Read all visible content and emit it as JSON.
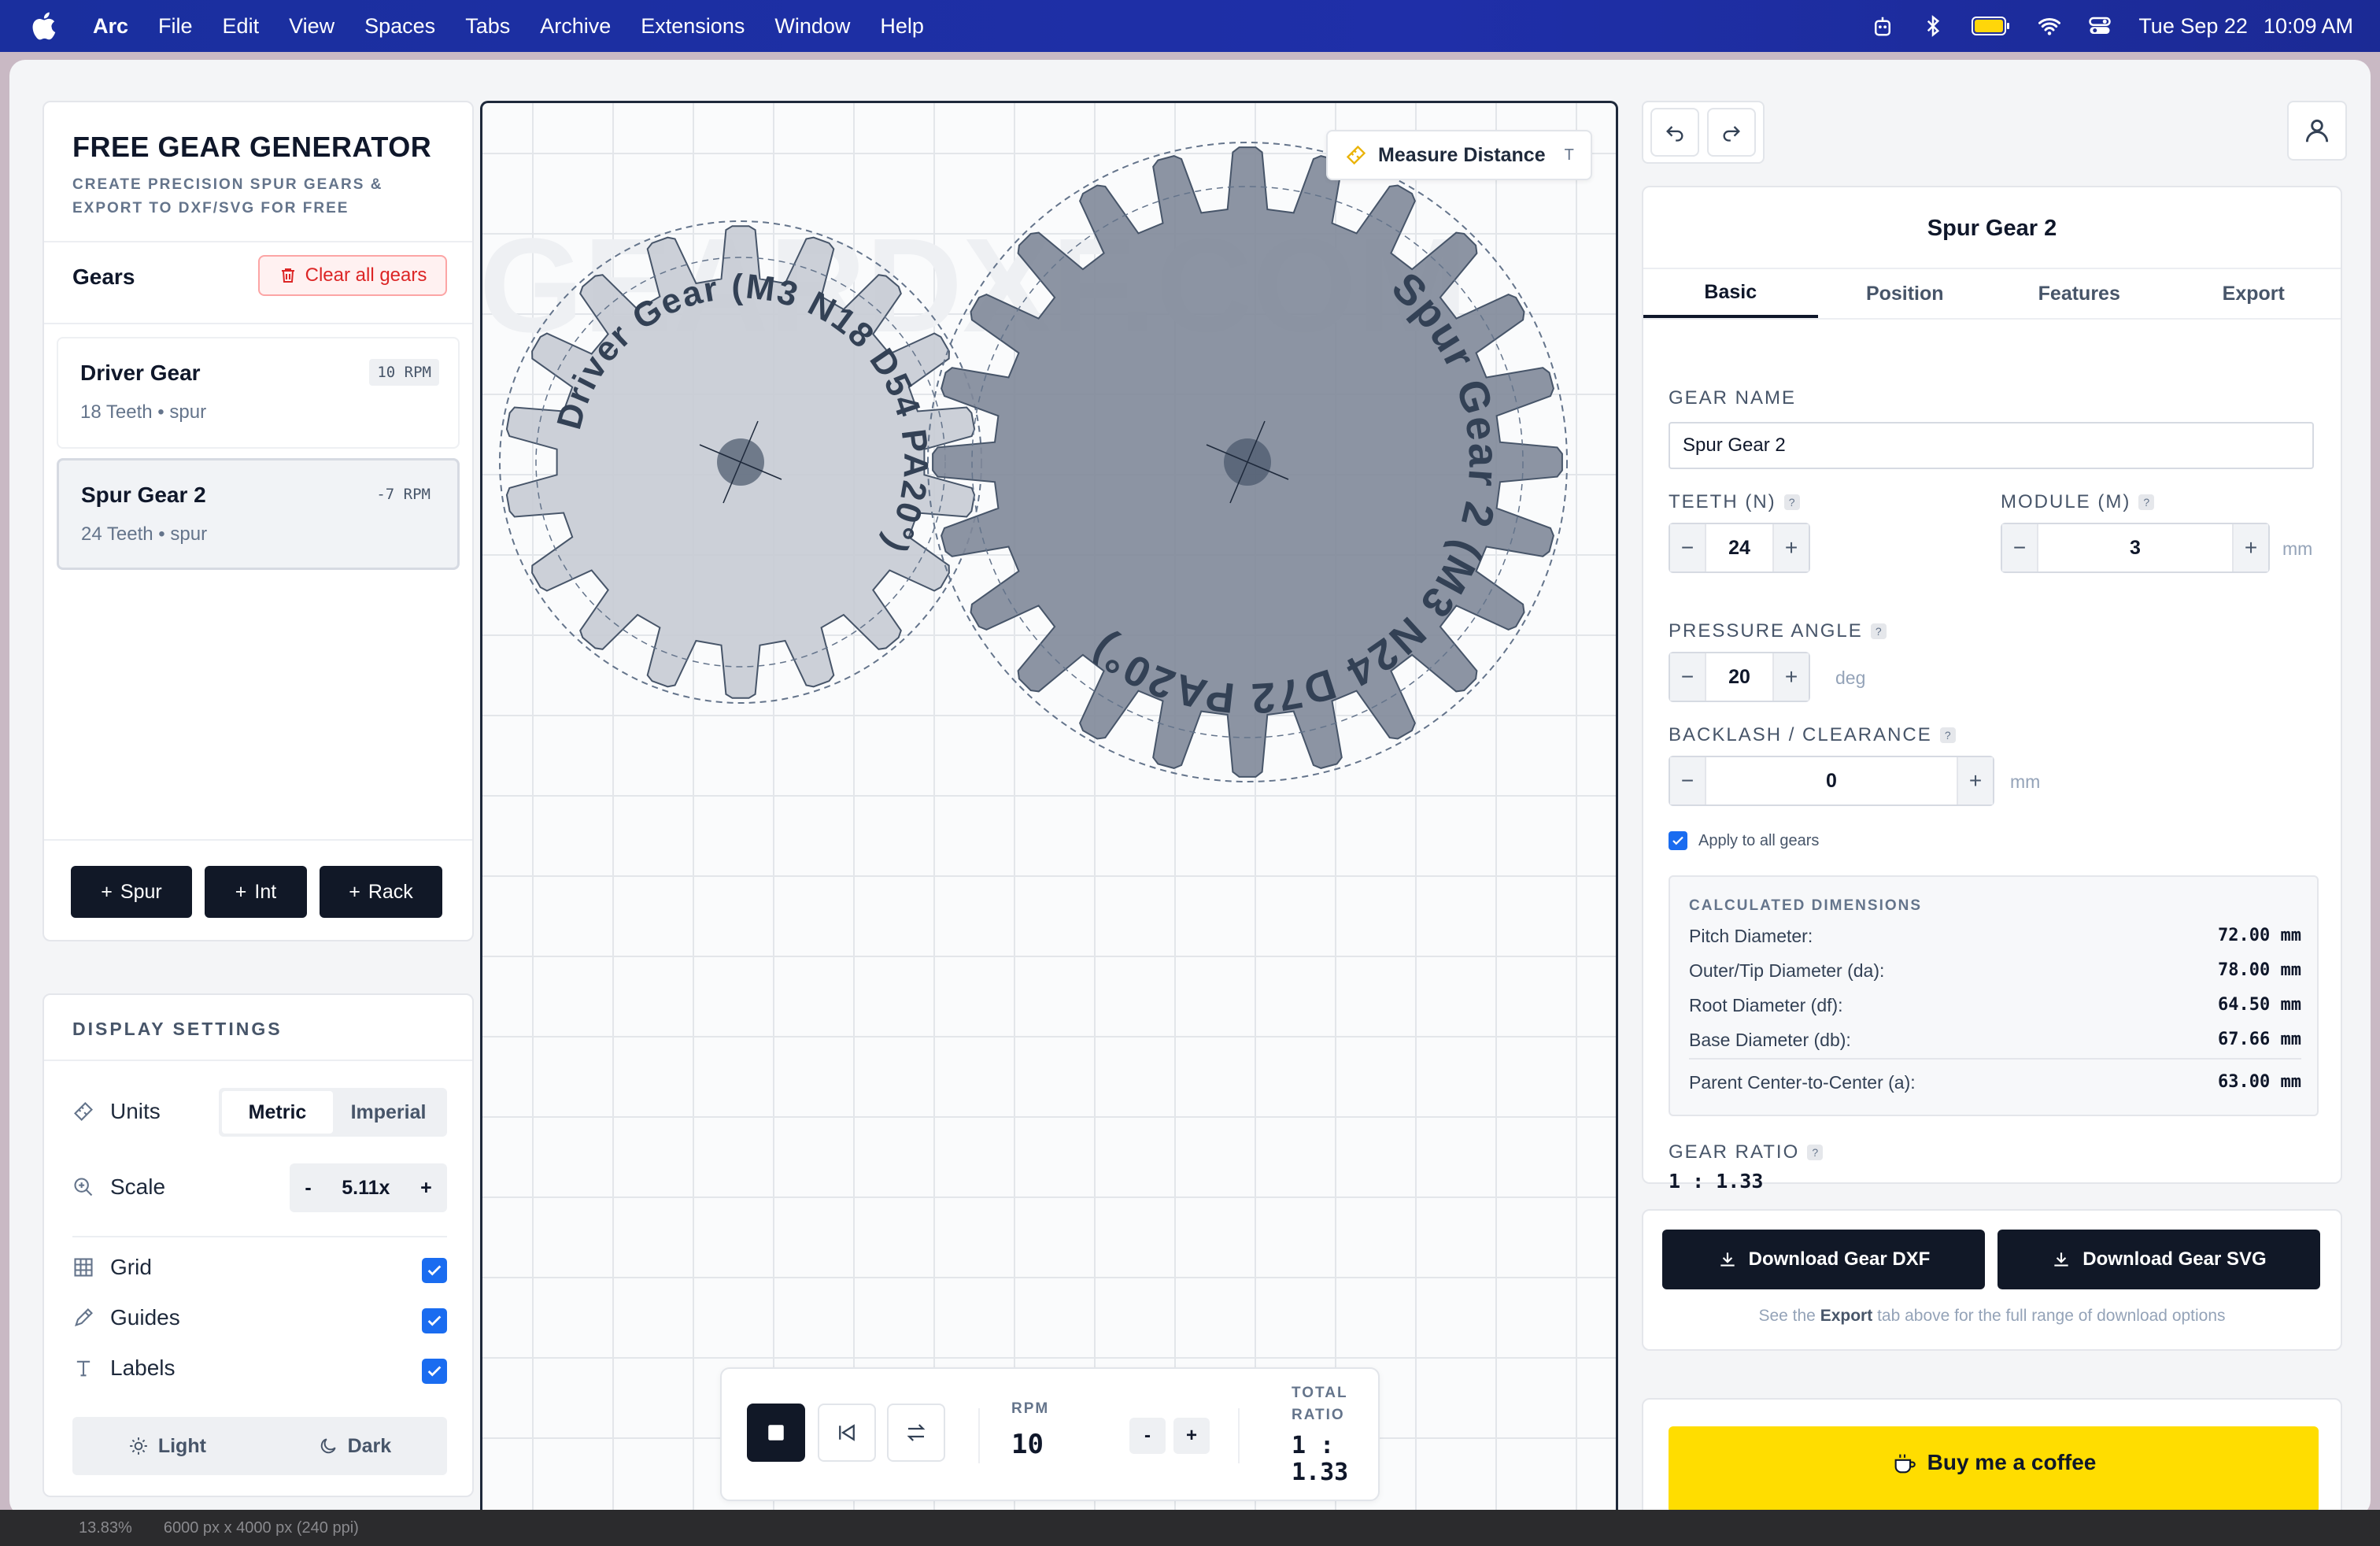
{
  "menubar": {
    "app": "Arc",
    "items": [
      "File",
      "Edit",
      "View",
      "Spaces",
      "Tabs",
      "Archive",
      "Extensions",
      "Window",
      "Help"
    ],
    "date": "Tue Sep 22",
    "time": "10:09 AM"
  },
  "left": {
    "title": "FREE GEAR GENERATOR",
    "subtitle": "CREATE PRECISION SPUR GEARS & EXPORT TO DXF/SVG FOR FREE",
    "gears_heading": "Gears",
    "clear_label": "Clear all gears",
    "gears": [
      {
        "name": "Driver Gear",
        "meta": "18 Teeth • spur",
        "rpm": "10 RPM"
      },
      {
        "name": "Spur Gear 2",
        "meta": "24 Teeth • spur",
        "rpm": "-7 RPM"
      }
    ],
    "add_buttons": [
      "Spur",
      "Int",
      "Rack"
    ]
  },
  "settings": {
    "title": "DISPLAY SETTINGS",
    "units_label": "Units",
    "units_options": [
      "Metric",
      "Imperial"
    ],
    "units_selected": "Metric",
    "scale_label": "Scale",
    "scale_minus": "-",
    "scale_value": "5.11x",
    "scale_plus": "+",
    "grid_label": "Grid",
    "guides_label": "Guides",
    "labels_label": "Labels",
    "grid_on": true,
    "guides_on": true,
    "labels_on": true,
    "theme_light": "Light",
    "theme_dark": "Dark"
  },
  "canvas": {
    "watermark": "GEARDXF.COM",
    "measure_label": "Measure Distance",
    "measure_key": "T",
    "driver_label": "Driver Gear (M3 N18 D54 PA20°)",
    "spur2_label": "Spur Gear 2 (M3 N24 D72 PA20°)",
    "driver_teeth": 18,
    "spur2_teeth": 24,
    "colors": {
      "driver_fill": "#c7cbd4",
      "spur2_fill": "#7f8899",
      "grid": "#e3e6ea"
    },
    "playbar": {
      "rpm_label": "RPM",
      "rpm_value": "10",
      "minus": "-",
      "plus": "+",
      "total_label_1": "TOTAL",
      "total_label_2": "RATIO",
      "total_value_1": "1 :",
      "total_value_2": "1.33"
    }
  },
  "props": {
    "title": "Spur Gear 2",
    "tabs": [
      "Basic",
      "Position",
      "Features",
      "Export"
    ],
    "active_tab": "Basic",
    "gear_name_label": "GEAR NAME",
    "gear_name_value": "Spur Gear 2",
    "teeth_label": "TEETH (N)",
    "teeth_value": "24",
    "module_label": "MODULE (M)",
    "module_value": "3",
    "module_unit": "mm",
    "pressure_label": "PRESSURE ANGLE",
    "pressure_value": "20",
    "pressure_unit": "deg",
    "backlash_label": "BACKLASH / CLEARANCE",
    "backlash_value": "0",
    "backlash_unit": "mm",
    "apply_all_label": "Apply to all gears",
    "apply_all_checked": true,
    "calc_title": "CALCULATED DIMENSIONS",
    "calc_rows": [
      {
        "label": "Pitch Diameter:",
        "value": "72.00 mm"
      },
      {
        "label": "Outer/Tip Diameter (da):",
        "value": "78.00 mm"
      },
      {
        "label": "Root Diameter (df):",
        "value": "64.50 mm"
      },
      {
        "label": "Base Diameter (db):",
        "value": "67.66 mm"
      }
    ],
    "center_label": "Parent Center-to-Center (a):",
    "center_value": "63.00 mm",
    "ratio_label": "GEAR RATIO",
    "ratio_value": "1 : 1.33",
    "help_mark": "?"
  },
  "download": {
    "dxf_label": "Download Gear DXF",
    "svg_label": "Download Gear SVG",
    "note_pre": "See the",
    "note_bold": "Export",
    "note_post": "tab above for the full range of download options"
  },
  "coffee": {
    "label": "Buy me a coffee"
  },
  "statusbar": {
    "zoom": "13.83%",
    "dims": "6000 px x 4000 px (240 ppi)"
  }
}
